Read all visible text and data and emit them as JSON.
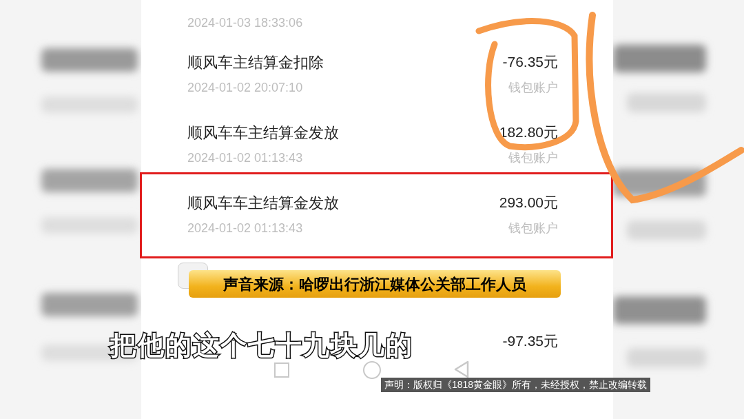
{
  "transactions": [
    {
      "time": "2024-01-03 18:33:06",
      "highlighted": false
    },
    {
      "title": "顺风车主结算金扣除",
      "amount": "-76.35元",
      "time": "2024-01-02 20:07:10",
      "account": "钱包账户",
      "highlighted": false
    },
    {
      "title": "顺风车车主结算金发放",
      "amount": "182.80元",
      "time": "2024-01-02 01:13:43",
      "account": "钱包账户",
      "highlighted": false
    },
    {
      "title": "顺风车车主结算金发放",
      "amount": "293.00元",
      "time": "2024-01-02 01:13:43",
      "account": "钱包账户",
      "highlighted": true
    },
    {
      "amount": "-97.35元",
      "highlighted": false
    }
  ],
  "caption": {
    "label": "声音来源：哈啰出行浙江媒体公关部工作人员"
  },
  "subtitle": "把他的这个七十九块几的",
  "disclaimer": "声明：版权归《1818黄金眼》所有，未经授权，禁止改编转载"
}
